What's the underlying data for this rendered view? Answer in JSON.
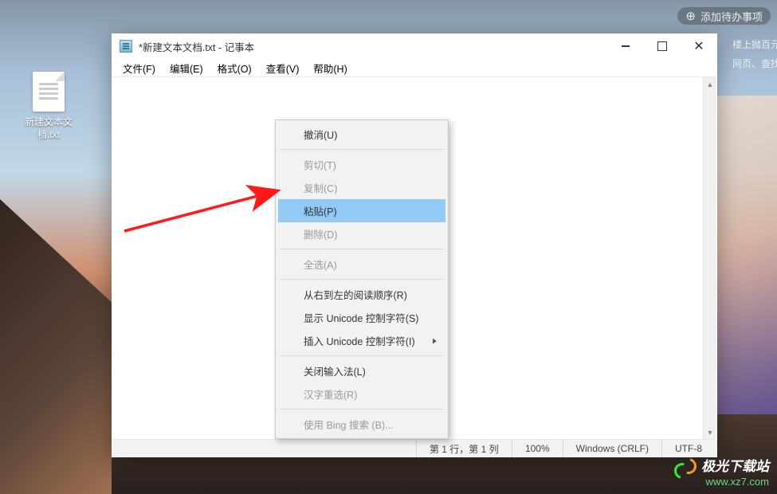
{
  "top_banner": {
    "icon": "⊕",
    "text": "添加待办事项"
  },
  "side_news": [
    "楼上抛百元钞票",
    "网页、查找文件"
  ],
  "desktop_icon": {
    "label": "新建文本文档.txt"
  },
  "window": {
    "title": "*新建文本文档.txt - 记事本",
    "menus": [
      "文件(F)",
      "编辑(E)",
      "格式(O)",
      "查看(V)",
      "帮助(H)"
    ],
    "win_controls": {
      "close_glyph": "✕"
    }
  },
  "context_menu": [
    {
      "label": "撤消(U)",
      "enabled": true,
      "highlight": false,
      "sub": false
    },
    {
      "sep": true
    },
    {
      "label": "剪切(T)",
      "enabled": false,
      "highlight": false,
      "sub": false
    },
    {
      "label": "复制(C)",
      "enabled": false,
      "highlight": false,
      "sub": false
    },
    {
      "label": "粘贴(P)",
      "enabled": true,
      "highlight": true,
      "sub": false
    },
    {
      "label": "删除(D)",
      "enabled": false,
      "highlight": false,
      "sub": false
    },
    {
      "sep": true
    },
    {
      "label": "全选(A)",
      "enabled": false,
      "highlight": false,
      "sub": false
    },
    {
      "sep": true
    },
    {
      "label": "从右到左的阅读顺序(R)",
      "enabled": true,
      "highlight": false,
      "sub": false
    },
    {
      "label": "显示 Unicode 控制字符(S)",
      "enabled": true,
      "highlight": false,
      "sub": false
    },
    {
      "label": "插入 Unicode 控制字符(I)",
      "enabled": true,
      "highlight": false,
      "sub": true
    },
    {
      "sep": true
    },
    {
      "label": "关闭输入法(L)",
      "enabled": true,
      "highlight": false,
      "sub": false
    },
    {
      "label": "汉字重选(R)",
      "enabled": false,
      "highlight": false,
      "sub": false
    },
    {
      "sep": true
    },
    {
      "label": "使用 Bing 搜索 (B)...",
      "enabled": false,
      "highlight": false,
      "sub": false
    }
  ],
  "statusbar": {
    "position": "第 1 行，第 1 列",
    "zoom": "100%",
    "line_ending": "Windows (CRLF)",
    "encoding": "UTF-8"
  },
  "watermark": {
    "name": "极光下载站",
    "url": "www.xz7.com"
  }
}
